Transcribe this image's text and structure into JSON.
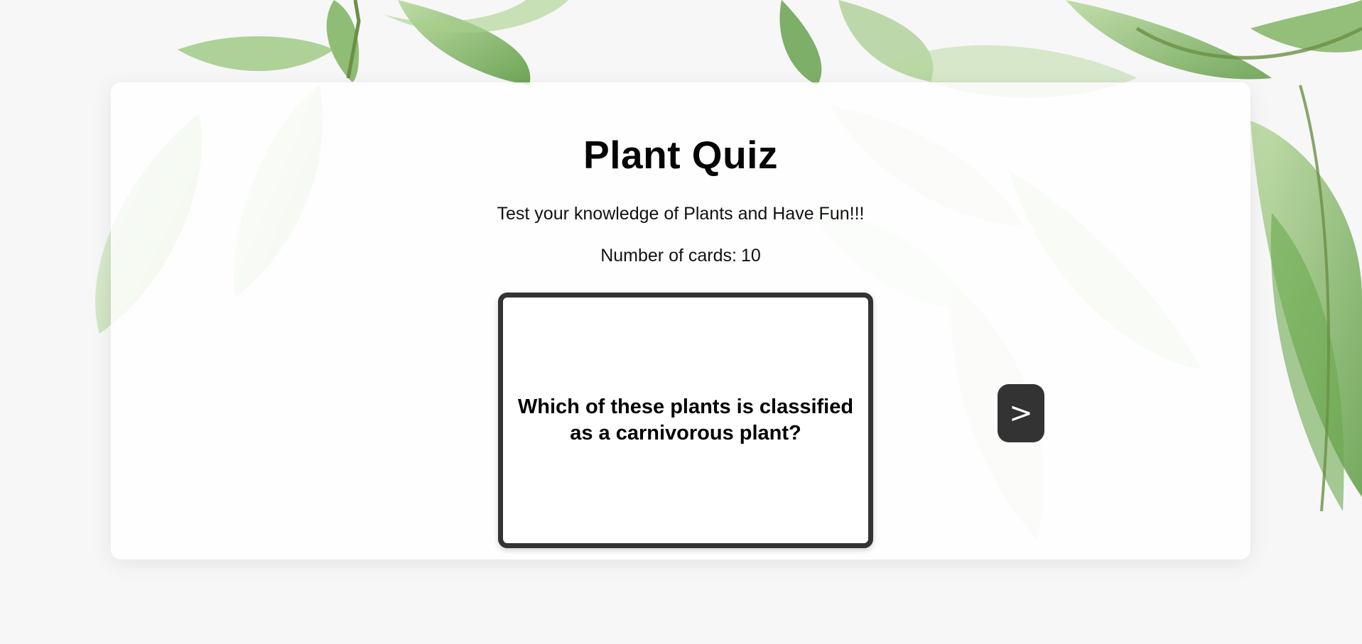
{
  "page": {
    "title": "Plant Quiz",
    "subtitle": "Test your knowledge of Plants and Have Fun!!!",
    "card_count_label": "Number of cards:",
    "card_count": "10"
  },
  "card": {
    "question": "Which of these plants is classified as a carnivorous plant?"
  },
  "nav": {
    "prev_label": "<",
    "next_label": ">"
  },
  "colors": {
    "button_bg": "#333333",
    "card_border": "#333333",
    "leaf_green": "#6aa84f"
  }
}
